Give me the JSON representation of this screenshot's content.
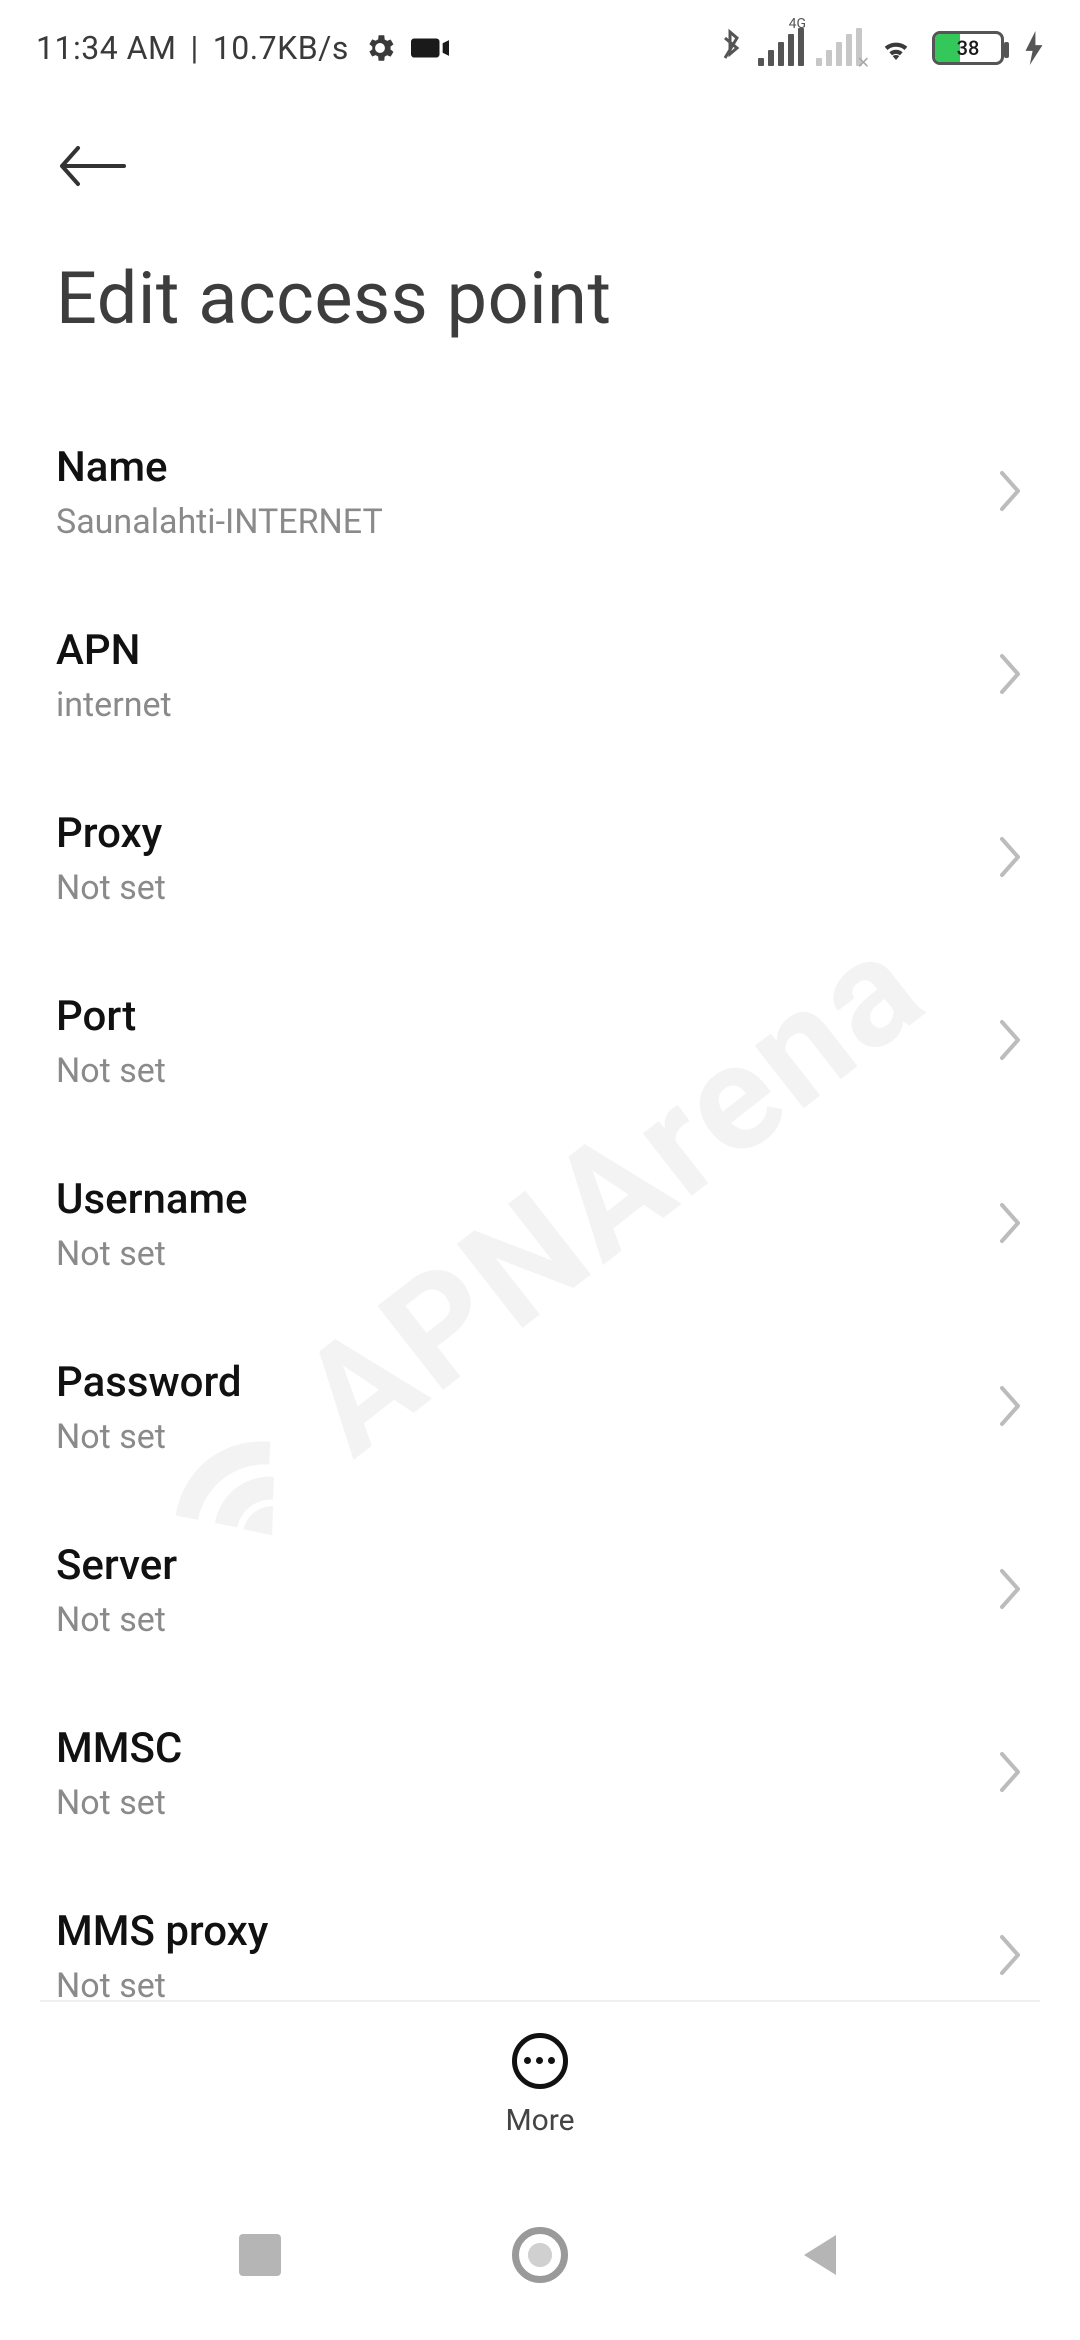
{
  "status": {
    "time": "11:34 AM",
    "sep": "|",
    "net_speed": "10.7KB/s",
    "signal1_tag": "4G",
    "battery_pct": "38"
  },
  "header": {
    "title": "Edit access point"
  },
  "settings": [
    {
      "id": "name",
      "label": "Name",
      "value": "Saunalahti-INTERNET"
    },
    {
      "id": "apn",
      "label": "APN",
      "value": "internet"
    },
    {
      "id": "proxy",
      "label": "Proxy",
      "value": "Not set"
    },
    {
      "id": "port",
      "label": "Port",
      "value": "Not set"
    },
    {
      "id": "username",
      "label": "Username",
      "value": "Not set"
    },
    {
      "id": "password",
      "label": "Password",
      "value": "Not set"
    },
    {
      "id": "server",
      "label": "Server",
      "value": "Not set"
    },
    {
      "id": "mmsc",
      "label": "MMSC",
      "value": "Not set"
    },
    {
      "id": "mms_proxy",
      "label": "MMS proxy",
      "value": "Not set"
    }
  ],
  "action_bar": {
    "more_label": "More"
  },
  "watermark": "APNArena"
}
